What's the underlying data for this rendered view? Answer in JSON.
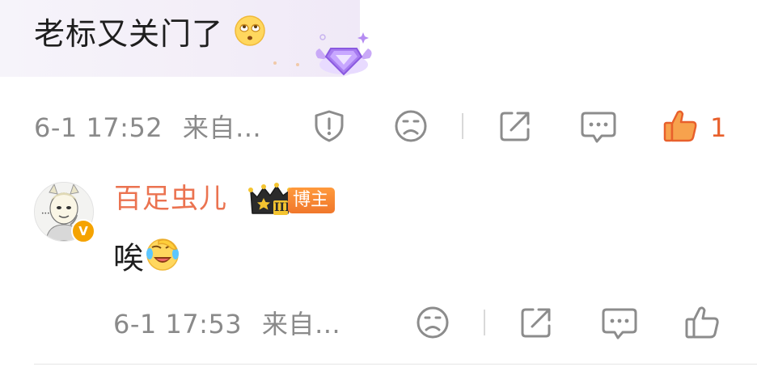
{
  "comment": {
    "text": "老标又关门了",
    "emoji_icon": "rolling-eyes-emoji",
    "fan_badge_icon": "purple-diamond-badge-icon",
    "meta": {
      "time": "6-1 17:52",
      "source": "来自…",
      "like_count": "1"
    }
  },
  "reply": {
    "username": "百足虫儿",
    "level_badge": "III",
    "role_tag": "博主",
    "verified_badge": "V",
    "text": "唉",
    "emoji_icon": "facepalm-laughing-emoji",
    "meta": {
      "time": "6-1 17:53",
      "source": "来自…"
    }
  },
  "colors": {
    "username": "#eb7350",
    "like_active": "#e8602c",
    "meta_text": "#8a8a8a",
    "icon_stroke": "#8c8c8c"
  }
}
